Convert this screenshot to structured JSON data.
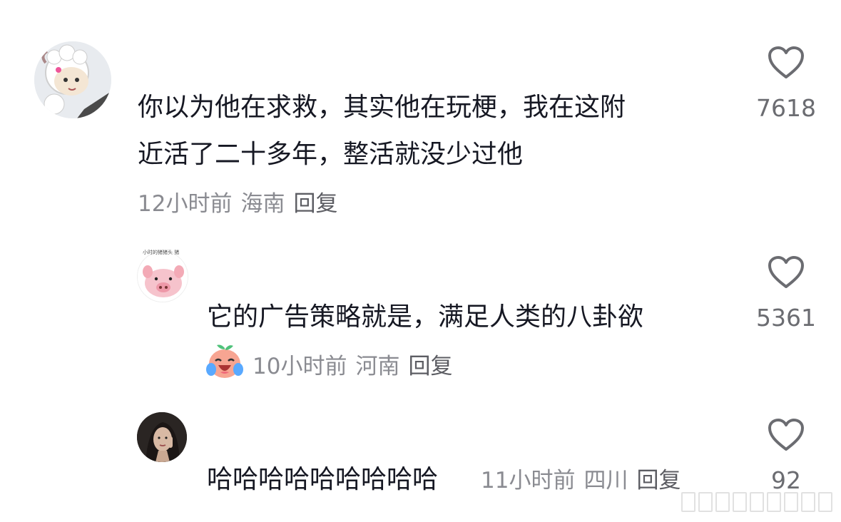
{
  "comments": [
    {
      "text_lines": [
        "你以为他在求救，其实他在玩梗，我在这附",
        "近活了二十多年，整活就没少过他"
      ],
      "time": "12小时前",
      "location": "海南",
      "reply_label": "回复",
      "likes": "7618"
    },
    {
      "text_lines": [
        "它的广告策略就是，满足人类的八卦欲"
      ],
      "time": "10小时前",
      "location": "河南",
      "reply_label": "回复",
      "likes": "5361",
      "emoji": "crying-laugh-peach-emoji",
      "avatar_caption": "小时的猪猪头 猪"
    },
    {
      "text_lines": [
        "哈哈哈哈哈哈哈哈哈"
      ],
      "time": "11小时前",
      "location": "四川",
      "reply_label": "回复",
      "likes": "92"
    }
  ],
  "icons": {
    "like": "heart-outline-icon",
    "watermark": "watermark-logo"
  },
  "colors": {
    "text": "#161823",
    "meta": "#8a8b91",
    "heart": "#6b6c71"
  }
}
